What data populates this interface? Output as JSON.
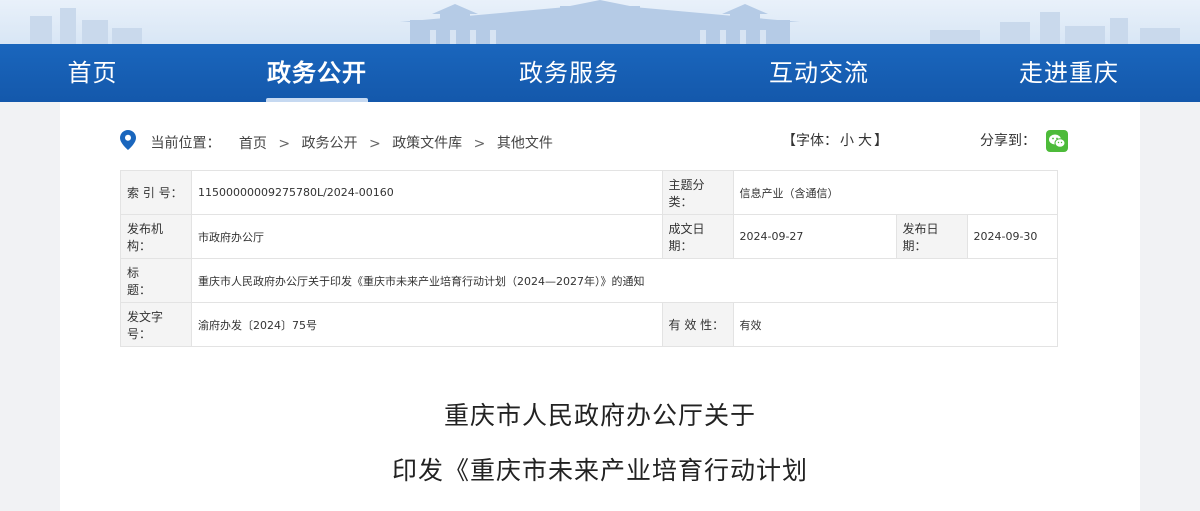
{
  "nav": {
    "items": [
      "首页",
      "政务公开",
      "政务服务",
      "互动交流",
      "走进重庆"
    ],
    "active_index": 1
  },
  "breadcrumb": {
    "label": "当前位置：",
    "items": [
      "首页",
      "政务公开",
      "政策文件库",
      "其他文件"
    ],
    "separator": ">"
  },
  "font_size": {
    "open": "【字体：",
    "small": "小",
    "large": "大",
    "close": "】"
  },
  "share": {
    "label": "分享到：",
    "icon": "wechat-icon"
  },
  "info": {
    "index_label": "索 引 号：",
    "index_value": "11500000009275780L/2024-00160",
    "topic_label": "主题分类：",
    "topic_value": "信息产业（含通信）",
    "issuer_label": "发布机构：",
    "issuer_value": "市政府办公厅",
    "written_label": "成文日期：",
    "written_value": "2024-09-27",
    "published_label": "发布日期：",
    "published_value": "2024-09-30",
    "title_label": "标　　题：",
    "title_value": "重庆市人民政府办公厅关于印发《重庆市未来产业培育行动计划（2024—2027年）》的通知",
    "docno_label": "发文字号：",
    "docno_value": "渝府办发〔2024〕75号",
    "validity_label": "有 效 性：",
    "validity_value": "有效"
  },
  "doc_title": {
    "line1": "重庆市人民政府办公厅关于",
    "line2": "印发《重庆市未来产业培育行动计划"
  },
  "colors": {
    "nav_bg": "#1a66bd",
    "wechat": "#4dbb3a",
    "pin": "#1a66bd"
  }
}
